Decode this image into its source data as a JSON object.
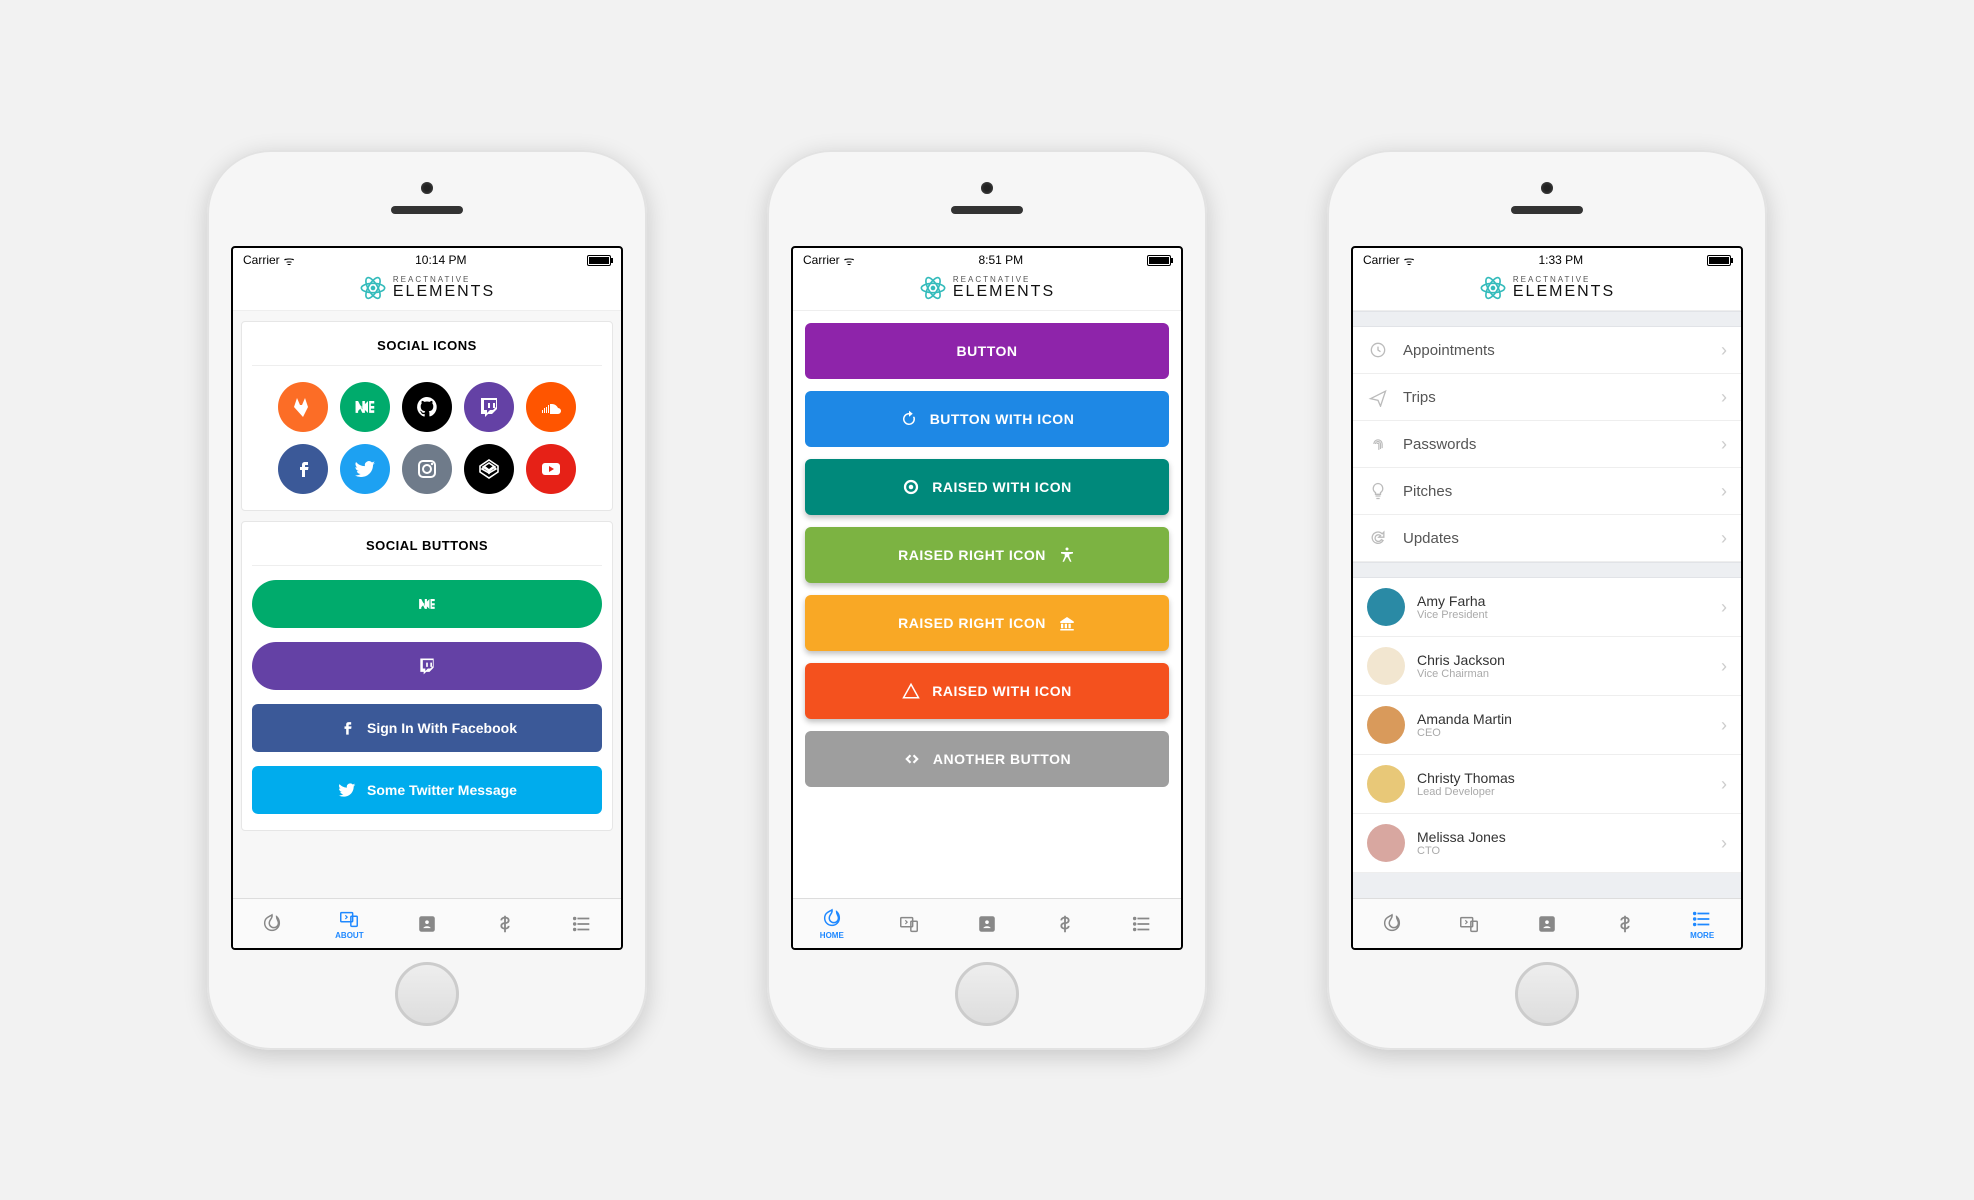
{
  "phone1": {
    "carrier": "Carrier",
    "time": "10:14 PM",
    "brand_top": "REACTNATIVE",
    "brand_bottom": "ELEMENTS",
    "card1_title": "SOCIAL ICONS",
    "card2_title": "SOCIAL BUTTONS",
    "social_icons": [
      {
        "name": "gitlab",
        "color": "#fc6d26"
      },
      {
        "name": "medium",
        "color": "#00ab6c"
      },
      {
        "name": "github",
        "color": "#000000"
      },
      {
        "name": "twitch",
        "color": "#6441a5"
      },
      {
        "name": "soundcloud",
        "color": "#ff5500"
      },
      {
        "name": "facebook",
        "color": "#3b5998"
      },
      {
        "name": "twitter",
        "color": "#1da1f2"
      },
      {
        "name": "instagram",
        "color": "#6f7b8a"
      },
      {
        "name": "codepen",
        "color": "#000000"
      },
      {
        "name": "youtube",
        "color": "#e62117"
      }
    ],
    "social_buttons": [
      {
        "name": "medium",
        "label": "",
        "color": "#00ab6c"
      },
      {
        "name": "twitch",
        "label": "",
        "color": "#6441a5"
      },
      {
        "name": "facebook",
        "label": "Sign In With Facebook",
        "color": "#3b5998"
      },
      {
        "name": "twitter",
        "label": "Some Twitter Message",
        "color": "#00aced"
      }
    ],
    "tabs": [
      {
        "name": "home",
        "label": ""
      },
      {
        "name": "about",
        "label": "ABOUT"
      },
      {
        "name": "contact",
        "label": ""
      },
      {
        "name": "pricing",
        "label": ""
      },
      {
        "name": "more",
        "label": ""
      }
    ],
    "active_tab": 1
  },
  "phone2": {
    "carrier": "Carrier",
    "time": "8:51 PM",
    "brand_top": "REACTNATIVE",
    "brand_bottom": "ELEMENTS",
    "buttons": [
      {
        "label": "BUTTON",
        "color": "#8e24aa",
        "icon": "",
        "iconpos": "none",
        "raised": false
      },
      {
        "label": "BUTTON WITH ICON",
        "color": "#1e88e5",
        "icon": "refresh",
        "iconpos": "left",
        "raised": false
      },
      {
        "label": "RAISED WITH ICON",
        "color": "#00897b",
        "icon": "record",
        "iconpos": "left",
        "raised": true
      },
      {
        "label": "RAISED RIGHT ICON",
        "color": "#7cb342",
        "icon": "accessibility",
        "iconpos": "right",
        "raised": true
      },
      {
        "label": "RAISED RIGHT ICON",
        "color": "#f9a825",
        "icon": "bank",
        "iconpos": "right",
        "raised": true
      },
      {
        "label": "RAISED WITH ICON",
        "color": "#f4511e",
        "icon": "warning",
        "iconpos": "left",
        "raised": true
      },
      {
        "label": "ANOTHER BUTTON",
        "color": "#9e9e9e",
        "icon": "code",
        "iconpos": "left",
        "raised": false
      }
    ],
    "tabs": [
      {
        "name": "home",
        "label": "HOME"
      },
      {
        "name": "about",
        "label": ""
      },
      {
        "name": "contact",
        "label": ""
      },
      {
        "name": "pricing",
        "label": ""
      },
      {
        "name": "more",
        "label": ""
      }
    ],
    "active_tab": 0
  },
  "phone3": {
    "carrier": "Carrier",
    "time": "1:33 PM",
    "brand_top": "REACTNATIVE",
    "brand_bottom": "ELEMENTS",
    "list_items": [
      {
        "icon": "clock",
        "label": "Appointments"
      },
      {
        "icon": "plane",
        "label": "Trips"
      },
      {
        "icon": "fingerprint",
        "label": "Passwords"
      },
      {
        "icon": "bulb",
        "label": "Pitches"
      },
      {
        "icon": "refresh",
        "label": "Updates"
      }
    ],
    "people": [
      {
        "name": "Amy Farha",
        "role": "Vice President",
        "avatar_bg": "#2a8aa5"
      },
      {
        "name": "Chris Jackson",
        "role": "Vice Chairman",
        "avatar_bg": "#f2e6d0"
      },
      {
        "name": "Amanda Martin",
        "role": "CEO",
        "avatar_bg": "#d99a5b"
      },
      {
        "name": "Christy Thomas",
        "role": "Lead Developer",
        "avatar_bg": "#e8c878"
      },
      {
        "name": "Melissa Jones",
        "role": "CTO",
        "avatar_bg": "#d8a7a0"
      }
    ],
    "tabs": [
      {
        "name": "home",
        "label": ""
      },
      {
        "name": "about",
        "label": ""
      },
      {
        "name": "contact",
        "label": ""
      },
      {
        "name": "pricing",
        "label": ""
      },
      {
        "name": "more",
        "label": "MORE"
      }
    ],
    "active_tab": 4
  }
}
